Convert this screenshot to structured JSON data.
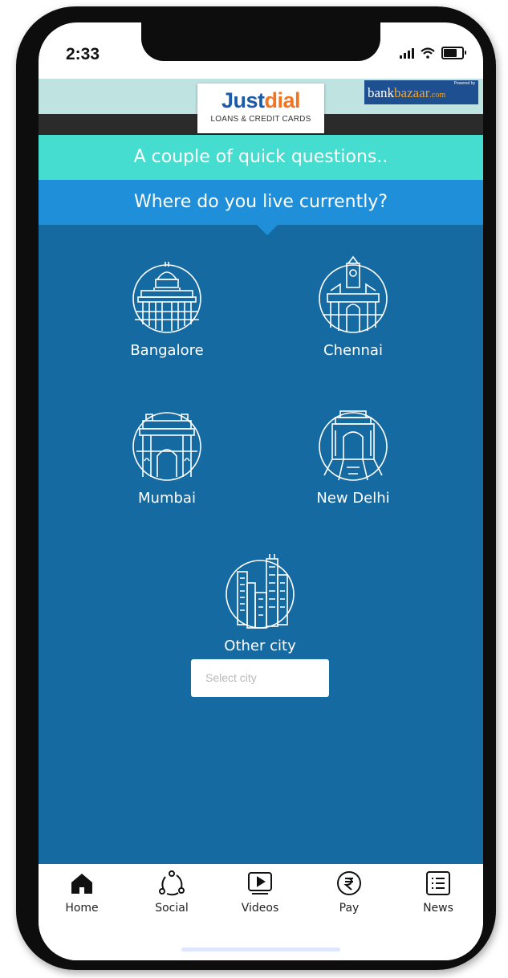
{
  "status_bar": {
    "time": "2:33"
  },
  "header": {
    "logo_part1": "Just",
    "logo_part2": "dial",
    "subtitle": "LOANS & CREDIT CARDS",
    "partner_a": "bank",
    "partner_b": "bazaar",
    "partner_c": ".com",
    "powered_by": "Powered by"
  },
  "banner": {
    "intro": "A couple of quick questions..",
    "question": "Where do you live currently?"
  },
  "cities": [
    {
      "label": "Bangalore",
      "icon": "bangalore-landmark-icon"
    },
    {
      "label": "Chennai",
      "icon": "chennai-landmark-icon"
    },
    {
      "label": "Mumbai",
      "icon": "mumbai-gateway-icon"
    },
    {
      "label": "New Delhi",
      "icon": "india-gate-icon"
    },
    {
      "label": "Other city",
      "icon": "city-skyline-icon"
    }
  ],
  "select": {
    "placeholder": "Select city"
  },
  "tabbar": [
    {
      "label": "Home",
      "icon": "home-icon"
    },
    {
      "label": "Social",
      "icon": "social-icon"
    },
    {
      "label": "Videos",
      "icon": "video-play-icon"
    },
    {
      "label": "Pay",
      "icon": "rupee-icon"
    },
    {
      "label": "News",
      "icon": "news-icon"
    }
  ],
  "colors": {
    "header_light": "#bfe3e1",
    "intro_bg": "#44ddd0",
    "question_bg": "#1f8fd9",
    "main_bg": "#166aa2",
    "justdial_blue": "#1a5aa8",
    "justdial_orange": "#f27420"
  }
}
